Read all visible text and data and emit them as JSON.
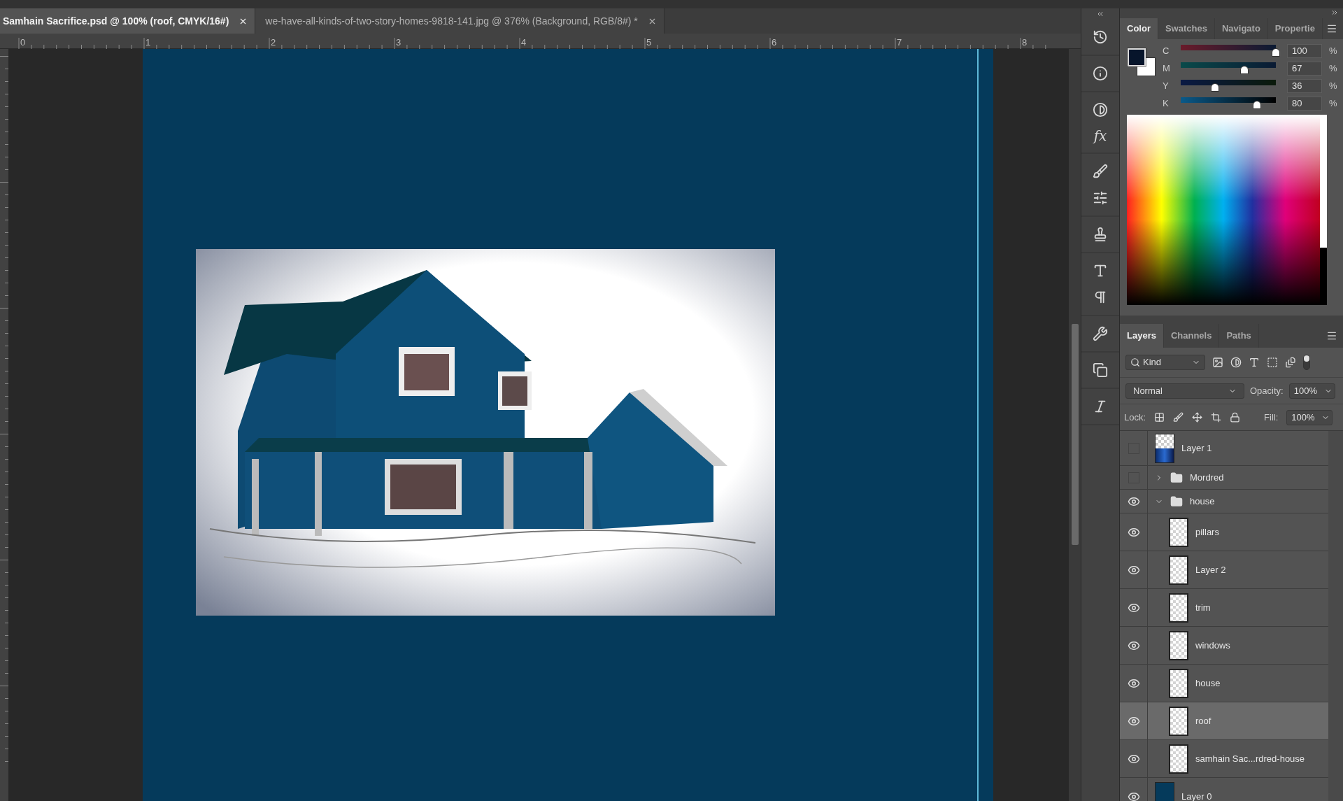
{
  "document_tabs": [
    {
      "label": "Samhain Sacrifice.psd @ 100% (roof, CMYK/16#)",
      "selected": true
    },
    {
      "label": "we-have-all-kinds-of-two-story-homes-9818-141.jpg @ 376% (Background, RGB/8#) *",
      "selected": false
    }
  ],
  "ruler": {
    "labels": [
      "0",
      "1",
      "2",
      "3",
      "4",
      "5",
      "6",
      "7",
      "8"
    ]
  },
  "tool_glyphs": {
    "styles": "fx"
  },
  "color_panel": {
    "tabs": [
      {
        "label": "Color",
        "selected": true
      },
      {
        "label": "Swatches",
        "selected": false
      },
      {
        "label": "Navigato",
        "selected": false
      },
      {
        "label": "Propertie",
        "selected": false
      }
    ],
    "sliders": [
      {
        "name": "C",
        "value": "100",
        "unit": "%",
        "level": 1.0
      },
      {
        "name": "M",
        "value": "67",
        "unit": "%",
        "level": 0.67
      },
      {
        "name": "Y",
        "value": "36",
        "unit": "%",
        "level": 0.36
      },
      {
        "name": "K",
        "value": "80",
        "unit": "%",
        "level": 0.8
      }
    ]
  },
  "layers_panel": {
    "tabs": [
      {
        "label": "Layers",
        "selected": true
      },
      {
        "label": "Channels",
        "selected": false
      },
      {
        "label": "Paths",
        "selected": false
      }
    ],
    "filter": "Kind",
    "blend_mode": "Normal",
    "opacity_label": "Opacity:",
    "opacity": "100%",
    "lock_label": "Lock:",
    "fill_label": "Fill:",
    "fill": "100%",
    "layers": [
      {
        "name": "Layer 1",
        "kind": "photo",
        "visible": false,
        "selected": false
      },
      {
        "name": "Mordred",
        "kind": "group",
        "visible": false,
        "expanded": false,
        "selected": false
      },
      {
        "name": "house",
        "kind": "group",
        "visible": true,
        "expanded": true,
        "selected": false,
        "children": [
          {
            "name": "pillars",
            "kind": "transparent",
            "visible": true,
            "selected": false
          },
          {
            "name": "Layer 2",
            "kind": "transparent",
            "visible": true,
            "selected": false
          },
          {
            "name": "trim",
            "kind": "transparent",
            "visible": true,
            "selected": false
          },
          {
            "name": "windows",
            "kind": "transparent",
            "visible": true,
            "selected": false
          },
          {
            "name": "house",
            "kind": "transparent",
            "visible": true,
            "selected": false
          },
          {
            "name": "roof",
            "kind": "transparent",
            "visible": true,
            "selected": true
          },
          {
            "name": "samhain Sac...rdred-house",
            "kind": "transparent",
            "visible": true,
            "selected": false
          }
        ]
      },
      {
        "name": "Layer 0",
        "kind": "fill",
        "visible": true,
        "selected": false
      }
    ]
  }
}
